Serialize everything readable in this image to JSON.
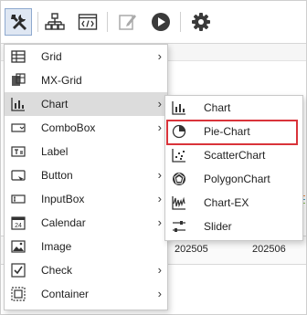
{
  "toolbar": {
    "buttons": [
      {
        "name": "tools-icon",
        "active": true
      },
      {
        "name": "hierarchy-icon",
        "active": false
      },
      {
        "name": "code-window-icon",
        "active": false
      },
      {
        "name": "edit-icon",
        "active": false
      },
      {
        "name": "play-icon",
        "active": false
      },
      {
        "name": "gear-icon",
        "active": false
      }
    ]
  },
  "background": {
    "columns": [
      "202505",
      "202506"
    ]
  },
  "main_menu": {
    "items": [
      {
        "label": "Grid",
        "icon": "grid-icon",
        "has_submenu": true
      },
      {
        "label": "MX-Grid",
        "icon": "mx-grid-icon",
        "has_submenu": false
      },
      {
        "label": "Chart",
        "icon": "bar-chart-icon",
        "has_submenu": true,
        "hover": true
      },
      {
        "label": "ComboBox",
        "icon": "combobox-icon",
        "has_submenu": true
      },
      {
        "label": "Label",
        "icon": "label-icon",
        "has_submenu": false
      },
      {
        "label": "Button",
        "icon": "button-icon",
        "has_submenu": true
      },
      {
        "label": "InputBox",
        "icon": "inputbox-icon",
        "has_submenu": true
      },
      {
        "label": "Calendar",
        "icon": "calendar-icon",
        "has_submenu": true
      },
      {
        "label": "Image",
        "icon": "image-icon",
        "has_submenu": false
      },
      {
        "label": "Check",
        "icon": "checkbox-icon",
        "has_submenu": true
      },
      {
        "label": "Container",
        "icon": "container-icon",
        "has_submenu": true
      }
    ]
  },
  "chart_submenu": {
    "items": [
      {
        "label": "Chart",
        "icon": "bar-chart-icon"
      },
      {
        "label": "Pie-Chart",
        "icon": "pie-chart-icon",
        "selected": true
      },
      {
        "label": "ScatterChart",
        "icon": "scatter-chart-icon"
      },
      {
        "label": "PolygonChart",
        "icon": "polygon-chart-icon"
      },
      {
        "label": "Chart-EX",
        "icon": "chart-ex-icon"
      },
      {
        "label": "Slider",
        "icon": "slider-icon"
      }
    ]
  },
  "colors": {
    "selection_border": "#d9333a",
    "hover_bg": "#dcdcdc",
    "toolbar_active_bg": "#dfe7f3"
  }
}
